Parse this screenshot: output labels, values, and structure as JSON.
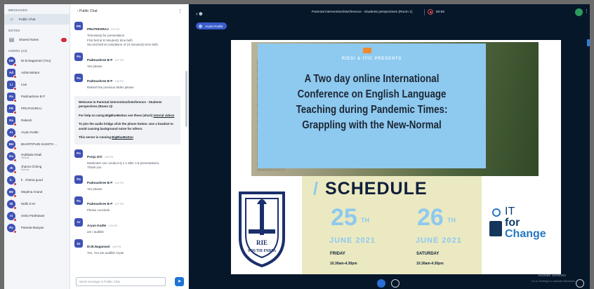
{
  "nav": {
    "messages_heading": "MESSAGES",
    "public_chat": "Public Chat",
    "notes_heading": "NOTES",
    "shared_notes": "Shared Notes",
    "users_heading": "USERS (23)",
    "users": [
      {
        "name": "Dr.B.Nagamani (You)",
        "initials": "DB",
        "color": "#3f51b5",
        "square": false
      },
      {
        "name": "Administrator",
        "initials": "Ad",
        "color": "#3f51b5",
        "square": true
      },
      {
        "name": "Live",
        "initials": "Li",
        "color": "#3f51b5",
        "square": true
      },
      {
        "name": "Padmashree B P",
        "initials": "Pa",
        "color": "#3f51b5",
        "square": true
      },
      {
        "name": "PRUTHIVIRAJ",
        "initials": "PR",
        "color": "#3f51b5",
        "square": true
      },
      {
        "name": "Rakesh",
        "initials": "Ra",
        "color": "#3f51b5",
        "square": true
      },
      {
        "name": "Aryan Kudte",
        "initials": "Ar",
        "color": "#3f51b5",
        "square": false
      },
      {
        "name": "BHARTIPUDI SAKETH ...",
        "initials": "BH",
        "color": "#3f51b5",
        "square": false
      },
      {
        "name": "Gubbala Hisali",
        "sub": "Ne5mk",
        "initials": "Gu",
        "color": "#3f51b5",
        "square": false
      },
      {
        "name": "Jharna Chiring",
        "sub": "Ne5mk",
        "initials": "Jh",
        "color": "#3f51b5",
        "square": false
      },
      {
        "name": "k . chetna goud",
        "initials": "k.",
        "color": "#3f51b5",
        "square": false
      },
      {
        "name": "Meghna Anand",
        "initials": "Me",
        "color": "#3f51b5",
        "square": false
      },
      {
        "name": "Nidhi D M",
        "initials": "Ni",
        "color": "#3f51b5",
        "square": false
      },
      {
        "name": "nisha Panthawar",
        "initials": "ni",
        "color": "#3f51b5",
        "square": false
      },
      {
        "name": "Pamela Mariyan",
        "initials": "Pa",
        "color": "#3f51b5",
        "square": false
      }
    ]
  },
  "chat": {
    "header": "‹ Public Chat",
    "messages_top": [
      {
        "name": "PRUTHIVIRAJ",
        "time": "3:57 PM",
        "initials": "PR",
        "lines": [
          "Timestamp for presentation",
          "First bell at 8 minutes(1 time bell)",
          "Second bell at completion of 10 minutes(2 time bell)"
        ]
      },
      {
        "name": "Padmashree B P",
        "time": "3:57 PM",
        "initials": "Pa",
        "lines": [
          "Yes please"
        ]
      },
      {
        "name": "Padmashree B P",
        "time": "3:58 PM",
        "initials": "Pa",
        "lines": [
          "Rakesh the previous slides please"
        ]
      }
    ],
    "welcome": {
      "title": "Welcome to Parental intervention/interference - Students perspectives (Room 1)!",
      "help_prefix": "For help on using BigBlueButton see these (short) ",
      "help_link": "tutorial videos",
      "audio": "To join the audio bridge click the phone button. Use a headset to avoid causing background noise for others.",
      "running_prefix": "This server is running ",
      "running_link": "BigBlueButton"
    },
    "messages_bottom": [
      {
        "name": "Pooja Giri",
        "time": "4:06 PM",
        "initials": "Po",
        "lines": [
          "Moderator can conduct Q n A after 1-6 presentations.",
          "Thank you"
        ]
      },
      {
        "name": "Padmashree B P",
        "time": "4:06 PM",
        "initials": "Pa",
        "lines": [
          "Yes please"
        ]
      },
      {
        "name": "Padmashree B P",
        "time": "4:07 PM",
        "initials": "Pa",
        "lines": [
          "Please conclude"
        ]
      },
      {
        "name": "Aryan Kudte",
        "time": "4:08 PM",
        "initials": "Ar",
        "lines": [
          "am I audible"
        ]
      },
      {
        "name": "Dr.B.Nagamani",
        "time": "4:08 PM",
        "initials": "Dr",
        "lines": [
          "Yes, You are audible Aryan"
        ]
      }
    ],
    "input_placeholder": "Send message to Public Chat"
  },
  "meeting": {
    "title": "Parental intervention/interference - Students perspectives (Room 1)",
    "timer": "50:56",
    "talking": "Aryan Kudte"
  },
  "slide": {
    "presents": "RIESI & ITIC PRESENTS",
    "heading_lines": [
      "A Two day online International",
      "Conference on English Language",
      "Teaching during Pandemic Times:",
      "Grappling with the New-Normal"
    ],
    "schedule": "SCHEDULE",
    "day1_num": "25",
    "day2_num": "26",
    "th": "TH",
    "month": "JUNE 2021",
    "day1_name": "FRIDAY",
    "day2_name": "SATURDAY",
    "time_range": "10.30am-4.30pm",
    "emblem_text": "RIE SOUTH INDIA",
    "itc_1": "IT",
    "itc_2": "for",
    "itc_3": "Change"
  },
  "watermark": {
    "line1": "Activate Windows",
    "line2": "Go to Settings to activate Windows."
  },
  "colors": {
    "accent": "#1f73d6",
    "banner": "#8ec9ef",
    "schedule_bg": "#ebe9c1",
    "dark_bg": "#06172a"
  }
}
